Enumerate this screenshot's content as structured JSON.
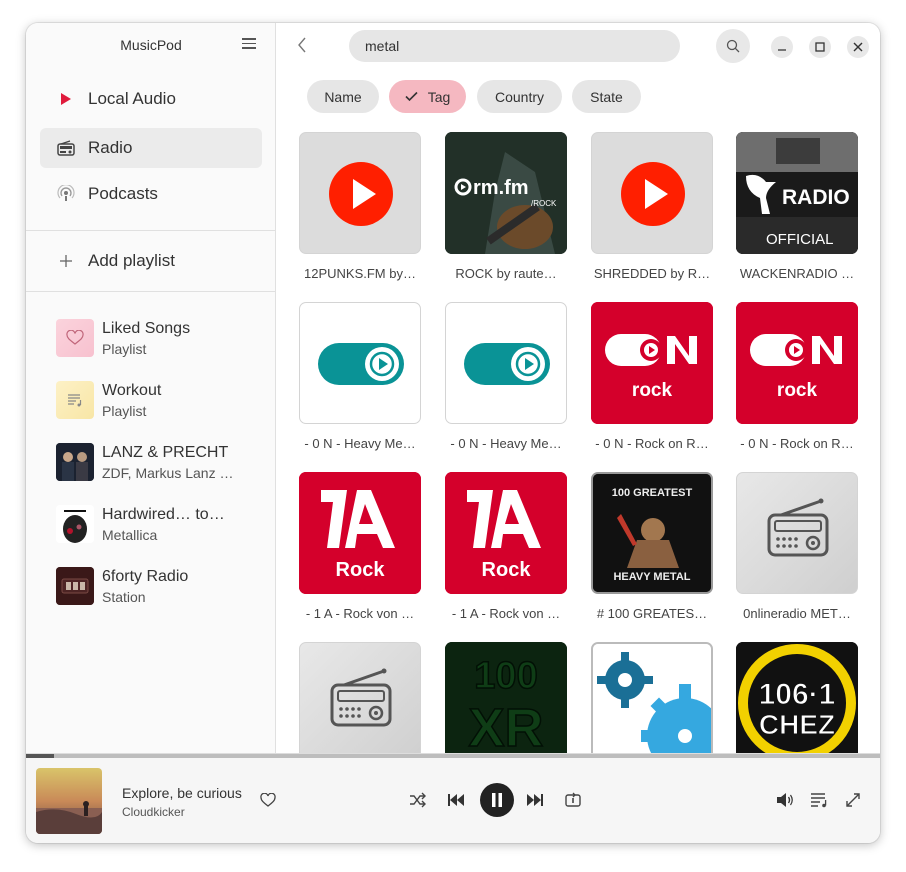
{
  "app": {
    "title": "MusicPod"
  },
  "nav": [
    {
      "label": "Local Audio",
      "icon": "play-triangle-icon"
    },
    {
      "label": "Radio",
      "icon": "radio-icon",
      "active": true
    },
    {
      "label": "Podcasts",
      "icon": "podcast-icon"
    }
  ],
  "add_playlist": {
    "label": "Add playlist"
  },
  "playlists": [
    {
      "title": "Liked Songs",
      "subtitle": "Playlist",
      "icon": "heart-icon"
    },
    {
      "title": "Workout",
      "subtitle": "Playlist",
      "icon": "list-music-icon"
    },
    {
      "title": "LANZ & PRECHT",
      "subtitle": "ZDF, Markus Lanz …",
      "icon": "podcast-cover"
    },
    {
      "title": "Hardwired… to…",
      "subtitle": "Metallica",
      "icon": "album-cover"
    },
    {
      "title": "6forty Radio",
      "subtitle": "Station",
      "icon": "station-cover"
    }
  ],
  "search": {
    "value": "metal"
  },
  "filters": [
    {
      "label": "Name",
      "active": false
    },
    {
      "label": "Tag",
      "active": true
    },
    {
      "label": "Country",
      "active": false
    },
    {
      "label": "State",
      "active": false
    }
  ],
  "stations": [
    {
      "caption": "12PUNKS.FM by…",
      "art": "youtube-play-icon"
    },
    {
      "caption": "ROCK by raute…",
      "art": "rm-fm-rock-logo",
      "logo_text": "rm.fm",
      "logo_sub": "/ROCK"
    },
    {
      "caption": "SHREDDED by R…",
      "art": "youtube-play-icon"
    },
    {
      "caption": "WACKENRADIO …",
      "art": "wacken-radio-logo",
      "logo_text": "RADIO",
      "logo_sub": "OFFICIAL"
    },
    {
      "caption": "- 0 N - Heavy Me…",
      "art": "toggle-play-logo"
    },
    {
      "caption": "- 0 N - Heavy Me…",
      "art": "toggle-play-logo"
    },
    {
      "caption": "- 0 N - Rock on R…",
      "art": "on-rock-logo",
      "logo_text": "rock"
    },
    {
      "caption": "- 0 N - Rock on R…",
      "art": "on-rock-logo",
      "logo_text": "rock"
    },
    {
      "caption": "- 1 A - Rock von …",
      "art": "1a-rock-logo",
      "logo_text": "Rock"
    },
    {
      "caption": "- 1 A - Rock von …",
      "art": "1a-rock-logo",
      "logo_text": "Rock"
    },
    {
      "caption": "# 100 GREATES…",
      "art": "100-greatest-heavy-metal-logo",
      "logo_text": "100 GREATEST",
      "logo_sub": "HEAVY METAL"
    },
    {
      "caption": "0nlineradio MET…",
      "art": "radio-placeholder-icon"
    },
    {
      "caption": "",
      "art": "radio-placeholder-icon"
    },
    {
      "caption": "",
      "art": "100-xr-logo",
      "logo_text": "100",
      "logo_sub": "XR"
    },
    {
      "caption": "",
      "art": "gears-logo"
    },
    {
      "caption": "",
      "art": "106-1-chez-logo",
      "logo_text": "106·1",
      "logo_sub": "CHEZ"
    }
  ],
  "player": {
    "title": "Explore, be curious",
    "artist": "Cloudkicker",
    "progress": 0.033
  },
  "colors": {
    "accent": "#e01b3c",
    "youtube_red": "#ff0000",
    "teal": "#0a9396",
    "rock_red": "#d4002b",
    "chip_active": "#f5b8c1"
  }
}
